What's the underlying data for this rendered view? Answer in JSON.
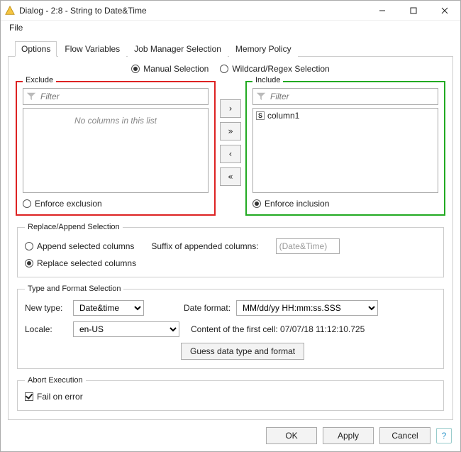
{
  "window": {
    "title": "Dialog - 2:8 - String to Date&Time"
  },
  "menubar": {
    "file": "File"
  },
  "tabs": {
    "options": "Options",
    "flow_variables": "Flow Variables",
    "job_manager": "Job Manager Selection",
    "memory_policy": "Memory Policy"
  },
  "selection_mode": {
    "manual": "Manual Selection",
    "regex": "Wildcard/Regex Selection"
  },
  "exclude": {
    "legend": "Exclude",
    "filter_placeholder": "Filter",
    "empty_text": "No columns in this list",
    "enforce_label": "Enforce exclusion"
  },
  "include": {
    "legend": "Include",
    "filter_placeholder": "Filter",
    "items": [
      {
        "type": "S",
        "name": "column1"
      }
    ],
    "enforce_label": "Enforce inclusion"
  },
  "move_buttons": {
    "right": "›",
    "right_all": "»",
    "left": "‹",
    "left_all": "«"
  },
  "replace_append": {
    "legend": "Replace/Append Selection",
    "append_label": "Append selected columns",
    "replace_label": "Replace selected columns",
    "suffix_label": "Suffix of appended columns:",
    "suffix_value": "(Date&Time)"
  },
  "type_format": {
    "legend": "Type and Format Selection",
    "new_type_label": "New type:",
    "new_type_value": "Date&time",
    "date_format_label": "Date format:",
    "date_format_value": "MM/dd/yy HH:mm:ss.SSS",
    "locale_label": "Locale:",
    "locale_value": "en-US",
    "first_cell_label": "Content of the first cell: 07/07/18 11:12:10.725",
    "guess_button": "Guess data type and format"
  },
  "abort": {
    "legend": "Abort Execution",
    "fail_label": "Fail on error"
  },
  "footer": {
    "ok": "OK",
    "apply": "Apply",
    "cancel": "Cancel",
    "help": "?"
  }
}
